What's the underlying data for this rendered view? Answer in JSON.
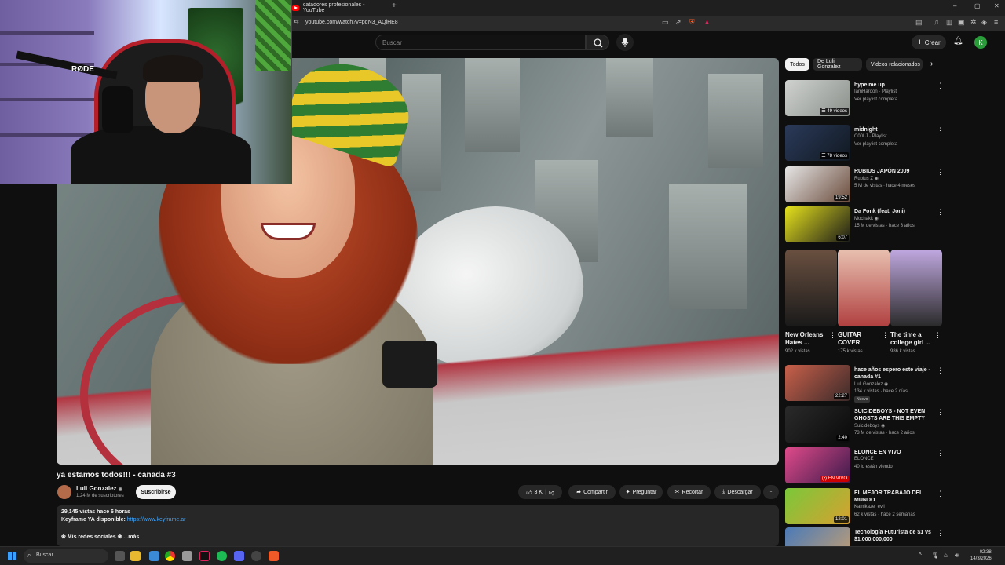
{
  "browser": {
    "tab_title": "catadores profesionales - YouTube",
    "new_tab": "+",
    "url": "youtube.com/watch?v=pqN3_AQlHE8",
    "window_controls": [
      "–",
      "▢",
      "✕"
    ]
  },
  "header": {
    "search_placeholder": "Buscar",
    "create_label": "Crear",
    "avatar_letter": "K"
  },
  "webcam": {
    "mic_brand": "RØDE"
  },
  "video": {
    "title": "ya estamos todos!!! - canada #3",
    "channel_name": "Luli Gonzalez",
    "channel_verified": "◉",
    "channel_subs": "1.24 M de suscriptores",
    "subscribe_label": "Suscribirse",
    "like_count": "3 K",
    "share_label": "Compartir",
    "ask_label": "Preguntar",
    "clip_label": "Recortar",
    "download_label": "Descargar",
    "more_label": "⋯"
  },
  "description": {
    "stats": "29,145 vistas  hace 6 horas",
    "line2_prefix": "Keyframe YA disponible: ",
    "line2_link": "https://www.keyframe.ar",
    "line3": "❀ Mis redes sociales ❀  ...más"
  },
  "sidebar": {
    "chips": [
      "Todos",
      "De Luli Gonzalez",
      "Videos relacionados"
    ],
    "recs": [
      {
        "title": "hype me up",
        "meta1": "IamHaroon · Playlist",
        "meta2": "Ver playlist completa",
        "badge": "☰ 49 videos",
        "color1": "#cfd2cf",
        "color2": "#8a8f8a"
      },
      {
        "title": "midnight",
        "meta1": "C00LJ · Playlist",
        "meta2": "Ver playlist completa",
        "badge": "☰ 78 videos",
        "color1": "#2b3a5a",
        "color2": "#101820"
      },
      {
        "title": "RUBIUS JAPÓN 2009",
        "meta1": "Rubius Z ◉",
        "meta2": "5 M de vistas · hace 4 meses",
        "badge": "19:52",
        "color1": "#e6e6e6",
        "color2": "#6a4a3a"
      },
      {
        "title": "Da Fonk (feat. Joni)",
        "meta1": "Mochakk ◉",
        "meta2": "15 M de vistas · hace 3 años",
        "badge": "6:07",
        "color1": "#e6e21c",
        "color2": "#1a1a1a"
      },
      {
        "title": "hace años espero este viaje - canada #1",
        "meta1": "Luli Gonzalez ◉",
        "meta2": "134 k vistas · hace 2 días",
        "badge": "22:27",
        "tag": "Nuevo",
        "color1": "#c9604a",
        "color2": "#3a2a2a"
      },
      {
        "title": "SUICIDEBOYS - NOT EVEN GHOSTS ARE THIS EMPTY",
        "meta1": "Suicideboys ◉",
        "meta2": "73 M de vistas · hace 2 años",
        "badge": "2:40",
        "color1": "#2a2a2a",
        "color2": "#0a0a0a"
      },
      {
        "title": "ELONCE EN VIVO",
        "meta1": "ELONCE",
        "meta2": "40 lo están viendo",
        "badge": "(•) EN VIVO",
        "live": true,
        "color1": "#e04a8a",
        "color2": "#3a1a4a"
      },
      {
        "title": "EL MEJOR TRABAJO DEL MUNDO",
        "meta1": "Kamikaze_evil",
        "meta2": "62 k vistas · hace 2 semanas",
        "badge": "12:01",
        "color1": "#7ac83a",
        "color2": "#d8a030"
      },
      {
        "title": "Tecnología Futurista de $1 vs $1,000,000,000",
        "meta1": "",
        "meta2": "",
        "badge": "",
        "color1": "#4a7ab8",
        "color2": "#c8a070"
      }
    ],
    "shorts": [
      {
        "title": "New Orleans Hates ...",
        "views": "902 k vistas",
        "color1": "#6a5040",
        "color2": "#1a1a1a"
      },
      {
        "title": "GUITAR COVER",
        "views": "175 k vistas",
        "color1": "#e8c0b0",
        "color2": "#b04040"
      },
      {
        "title": "The time a college girl ...",
        "views": "986 k vistas",
        "color1": "#c0a8e0",
        "color2": "#2a2a2a"
      }
    ]
  },
  "taskbar": {
    "search_label": "Buscar",
    "time": "02:38",
    "date": "14/3/2026"
  }
}
